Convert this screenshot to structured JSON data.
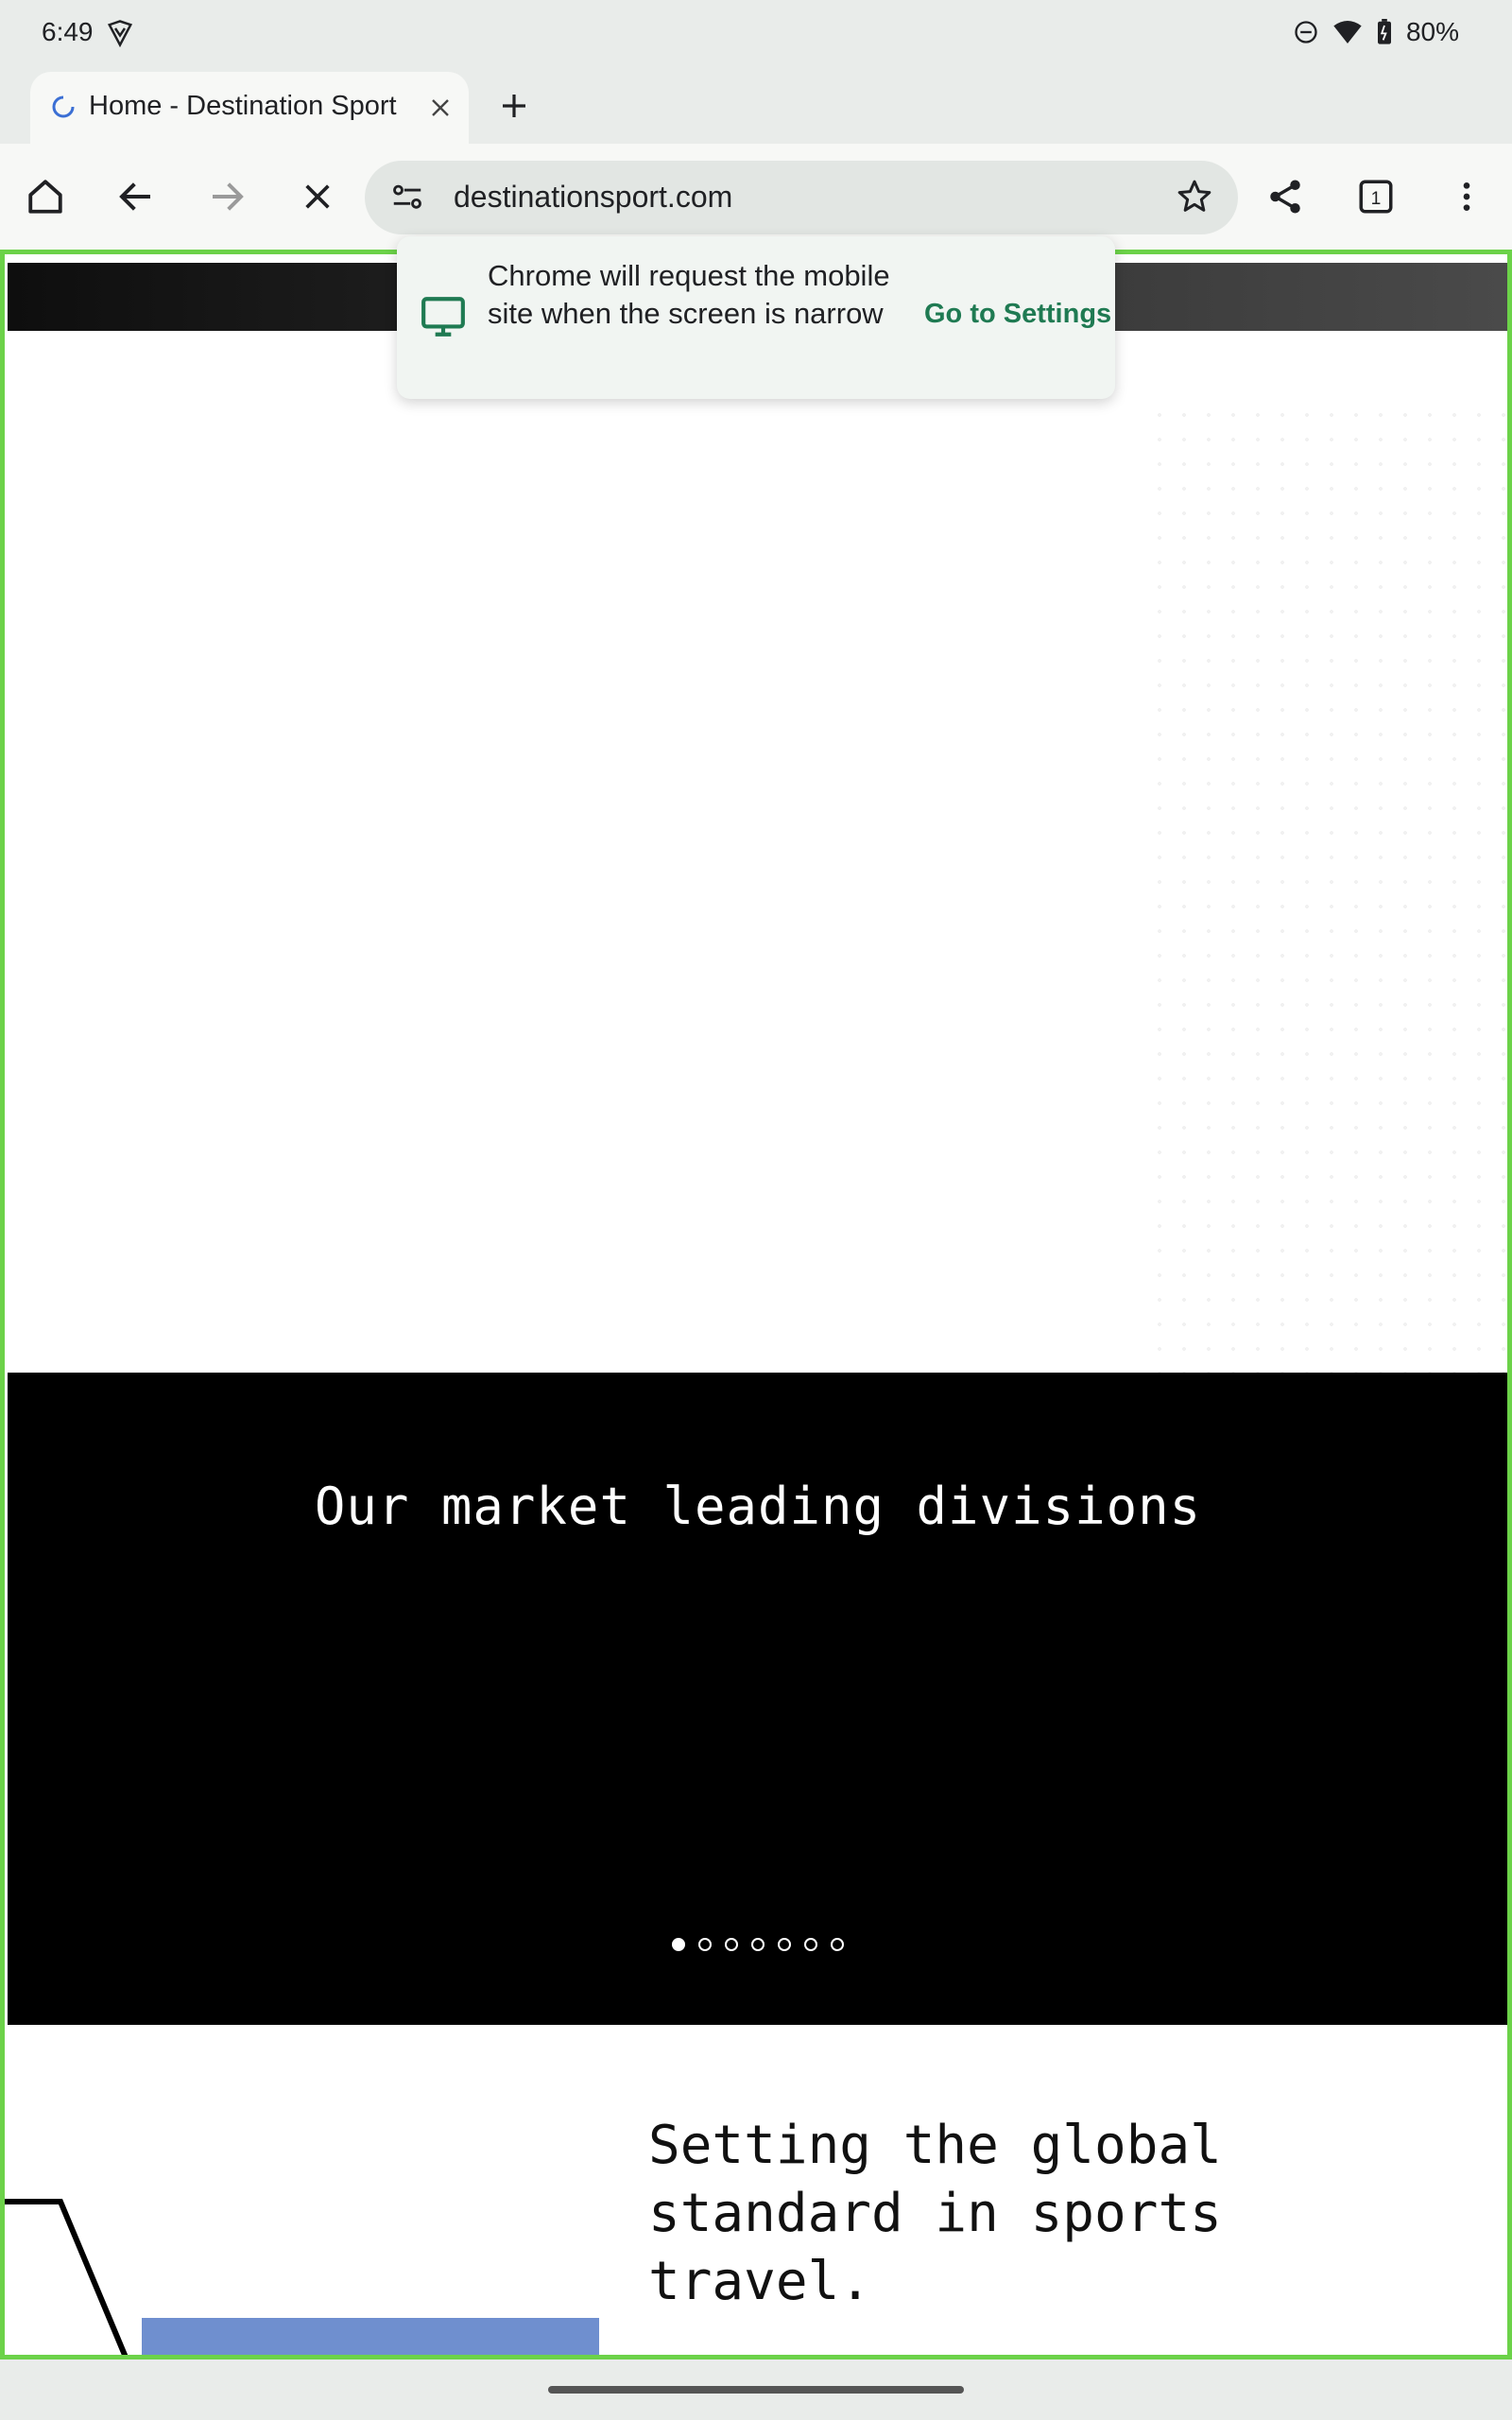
{
  "status_bar": {
    "time": "6:49",
    "battery": "80%"
  },
  "tab": {
    "title": "Home - Destination Sport"
  },
  "omnibox": {
    "url": "destinationsport.com"
  },
  "toolbar": {
    "tab_count": "1"
  },
  "popup": {
    "message": "Chrome will request the mobile site when the screen is narrow",
    "action": "Go to Settings"
  },
  "page": {
    "divisions_heading": "Our market leading divisions",
    "carousel": {
      "total": 7,
      "active": 1
    },
    "tagline": "Setting the global standard in sports travel."
  },
  "colors": {
    "accent_green": "#1f7a52",
    "frame_green": "#6cd249"
  }
}
